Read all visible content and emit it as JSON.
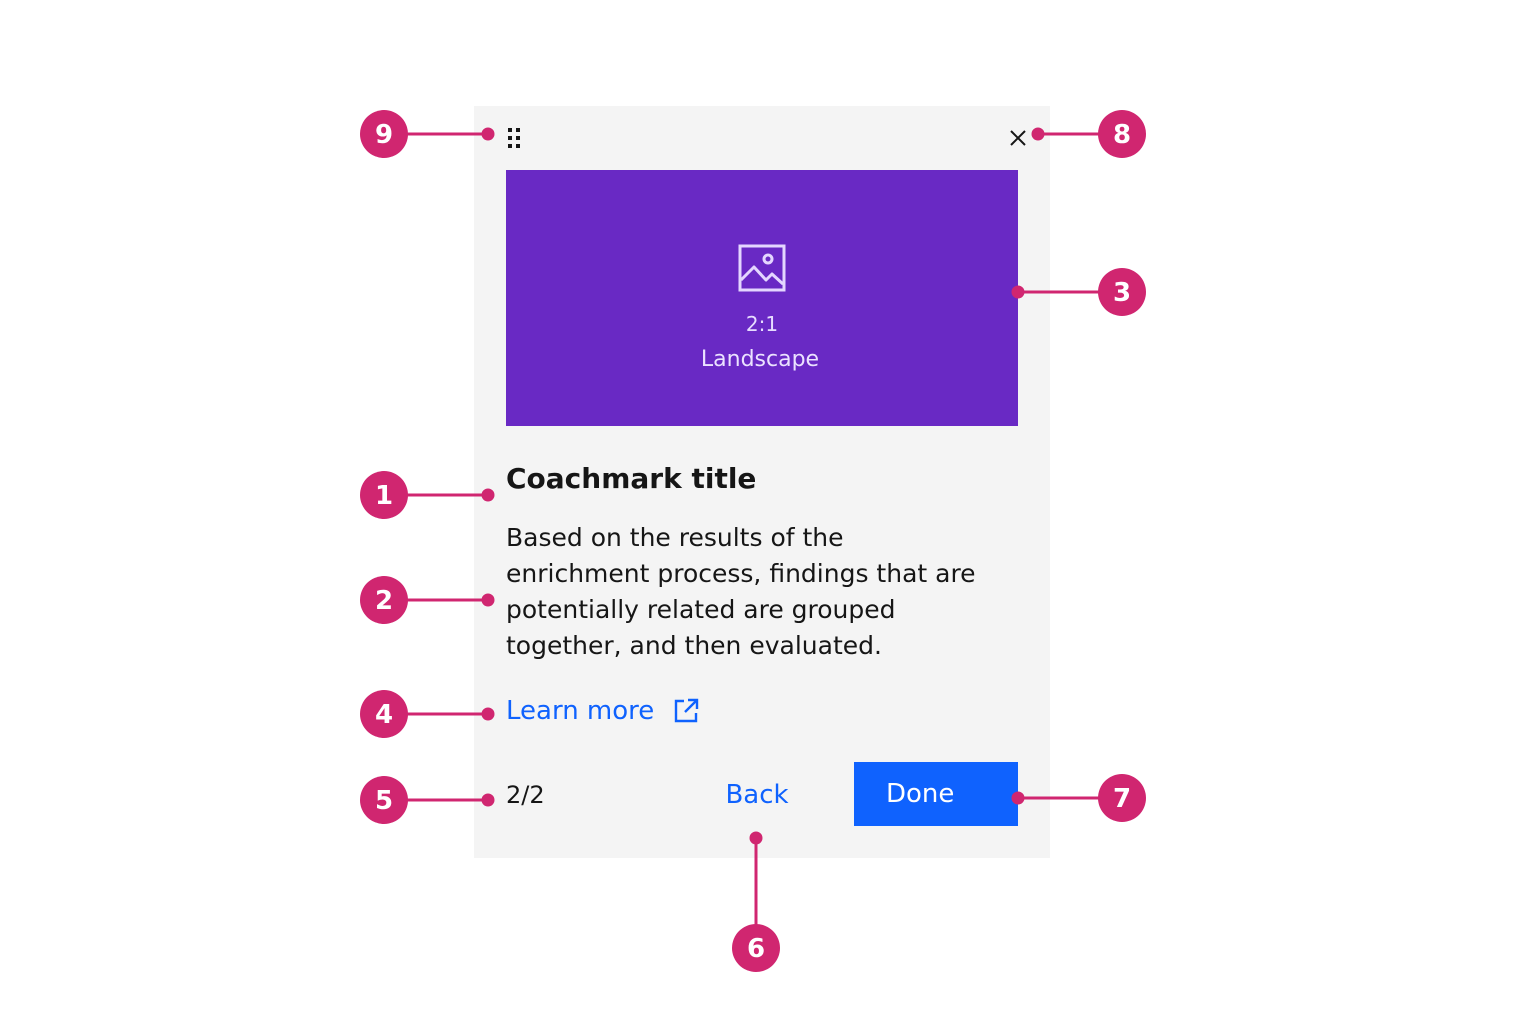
{
  "colors": {
    "card_background": "#f4f4f4",
    "media_background": "#6929c4",
    "primary": "#0f62fe",
    "annotation": "#d02670",
    "text": "#161616"
  },
  "header": {
    "drag_icon": "drag-handle-icon",
    "close_icon": "close-icon"
  },
  "media": {
    "icon": "image-icon",
    "ratio": "2:1",
    "label": "Landscape"
  },
  "content": {
    "title": "Coachmark title",
    "body_lines": [
      "Based on the results of the",
      "enrichment process, findings that are",
      "potentially related are grouped",
      "together, and then evaluated."
    ],
    "link_label": "Learn more",
    "link_icon": "launch-icon"
  },
  "footer": {
    "counter": "2/2",
    "back_label": "Back",
    "done_label": "Done"
  },
  "annotations": {
    "markers": [
      "1",
      "2",
      "3",
      "4",
      "5",
      "6",
      "7",
      "8",
      "9"
    ]
  }
}
